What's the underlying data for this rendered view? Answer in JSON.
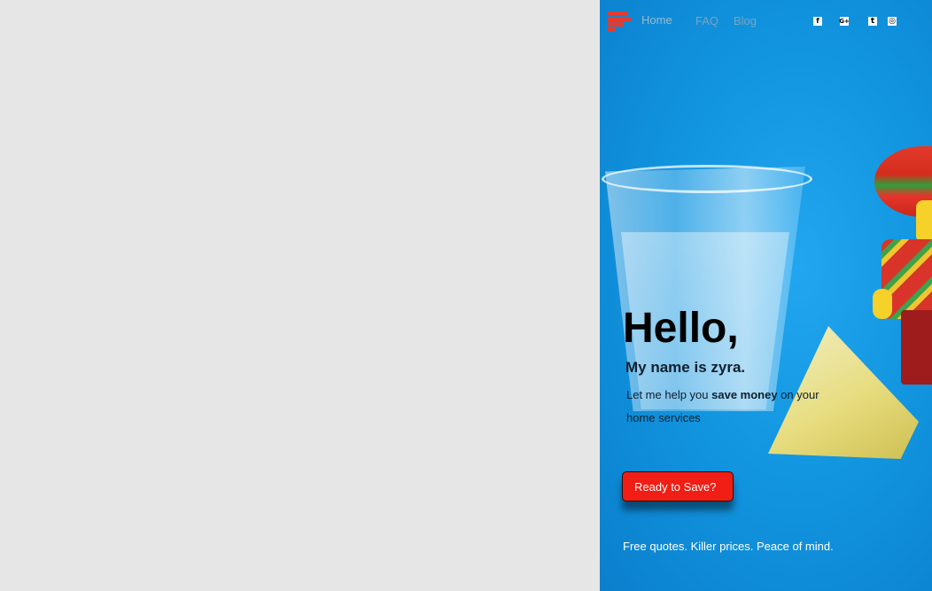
{
  "nav": {
    "links": [
      "Home",
      "FAQ",
      "Blog"
    ],
    "social": [
      "facebook-icon",
      "google-plus-icon",
      "twitter-icon",
      "instagram-icon"
    ]
  },
  "hero": {
    "greeting": "Hello,",
    "subtitle": "My name is zyra.",
    "desc_before": "Let me help you ",
    "desc_bold": "save money",
    "desc_after": " on your home services",
    "cta_label": "Ready to Save?",
    "tagline": "Free quotes. Killer prices. Peace of mind."
  },
  "colors": {
    "background_left": "#e6e6e6",
    "hero_blue": "#1296e0",
    "accent_red": "#f01e14",
    "logo_red": "#e53a2e"
  }
}
